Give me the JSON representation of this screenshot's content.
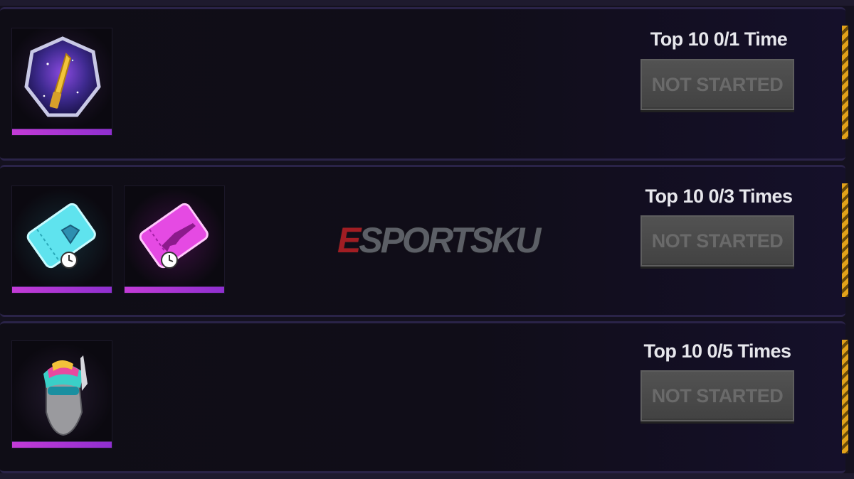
{
  "missions": [
    {
      "title": "Top 10 0/1 Time",
      "status": "NOT STARTED",
      "rewards": [
        "golden-knife-badge-icon"
      ]
    },
    {
      "title": "Top 10 0/3 Times",
      "status": "NOT STARTED",
      "rewards": [
        "diamond-voucher-icon",
        "weapon-voucher-icon"
      ]
    },
    {
      "title": "Top 10 0/5 Times",
      "status": "NOT STARTED",
      "rewards": [
        "rainbow-mask-headgear-icon"
      ]
    }
  ],
  "watermark": {
    "e": "E",
    "rest": "SPORTSKU"
  },
  "colors": {
    "accent": "#c33bd6",
    "scrollbar": "#e2a21a",
    "button_bg": "#4a4a4a",
    "button_text": "#6a6a6a",
    "watermark_red": "#a11d23"
  }
}
